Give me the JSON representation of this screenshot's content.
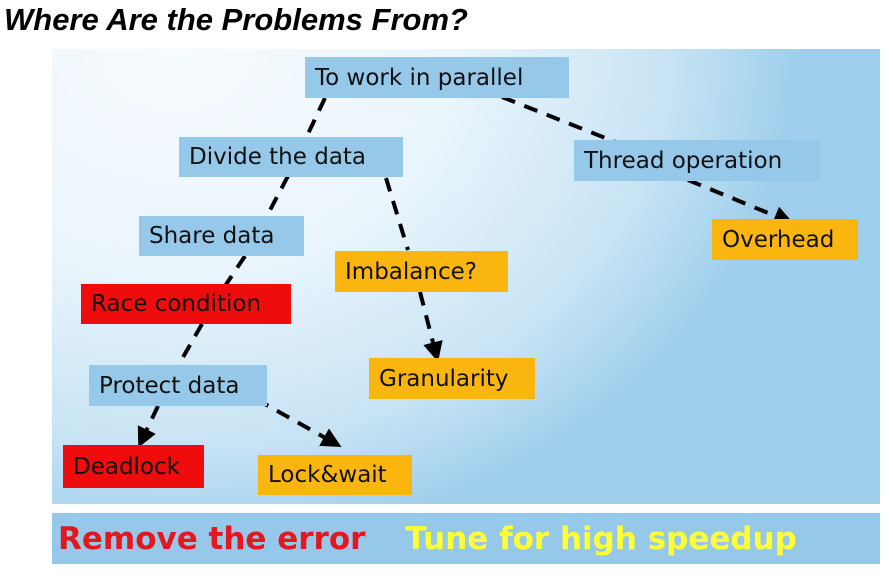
{
  "title": "Where Are the Problems From?",
  "nodes": {
    "parallel": "To work in parallel",
    "divide": "Divide the data",
    "thread": "Thread operation",
    "share": "Share data",
    "overhead": "Overhead",
    "imbalance": "Imbalance?",
    "race": "Race condition",
    "granularity": "Granularity",
    "protect": "Protect data",
    "deadlock": "Deadlock",
    "lockwait": "Lock&wait"
  },
  "footer": {
    "left": "Remove the error",
    "right": "Tune for high speedup"
  },
  "colors": {
    "blue_box": "#96c8ea",
    "orange_box": "#fbb50f",
    "red_box": "#ee0c0c",
    "footer_red_text": "#e3171e",
    "footer_yellow_text": "#ffff33"
  }
}
